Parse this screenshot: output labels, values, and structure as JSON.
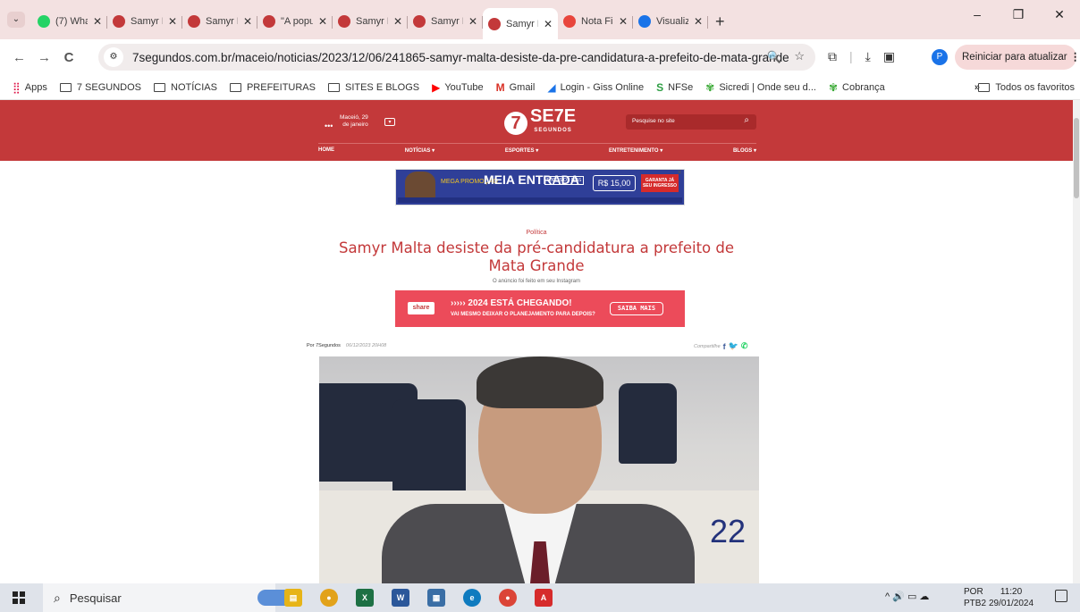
{
  "tabs": [
    {
      "label": "(7) Whats",
      "color": "#25D366",
      "active": false
    },
    {
      "label": "Samyr Ma",
      "color": "#c3393a",
      "active": false
    },
    {
      "label": "Samyr Ma",
      "color": "#c3393a",
      "active": false
    },
    {
      "label": "\"A popula",
      "color": "#c3393a",
      "active": false
    },
    {
      "label": "Samyr Ma",
      "color": "#c3393a",
      "active": false
    },
    {
      "label": "Samyr Ma",
      "color": "#c3393a",
      "active": false
    },
    {
      "label": "Samyr Ma",
      "color": "#c3393a",
      "active": true
    },
    {
      "label": "Nota Fisc",
      "color": "#e8453c",
      "active": false
    },
    {
      "label": "Visualizaç",
      "color": "#1a73e8",
      "active": false
    }
  ],
  "toolbar": {
    "url": "7segundos.com.br/maceio/noticias/2023/12/06/241865-samyr-malta-desiste-da-pre-candidatura-a-prefeito-de-mata-grande",
    "reload_label": "Reiniciar para atualizar",
    "profile_letter": "P"
  },
  "bookmarks": {
    "apps": "Apps",
    "items": [
      "7 SEGUNDOS",
      "NOTÍCIAS",
      "PREFEITURAS",
      "SITES E BLOGS",
      "YouTube",
      "Gmail",
      "Login - Giss Online",
      "NFSe",
      "Sicredi | Onde seu d...",
      "Cobrança"
    ],
    "more": "»",
    "all": "Todos os favoritos"
  },
  "site": {
    "date_line1": "Maceió, 29",
    "date_line2": "de janeiro",
    "logo_text": "SE7E",
    "logo_sub": "SEGUNDOS",
    "search_placeholder": "Pesquise no site",
    "menu": [
      "HOME",
      "NOTÍCIAS ▾",
      "ESPORTES ▾",
      "ENTRETENIMENTO ▾",
      "BLOGS ▾"
    ]
  },
  "ad1": {
    "promo": "MEGA PROMOÇÃO",
    "title": "MEIA ENTRADA",
    "note": "TODOS OS DIAS",
    "price": "R$ 15,00",
    "cta": "GARANTA JÁ SEU INGRESSO"
  },
  "article": {
    "category": "Política",
    "title": "Samyr Malta desiste da pré-candidatura a prefeito de Mata Grande",
    "subtitle": "O anúncio foi feito em seu Instagram",
    "author": "Por 7Segundos",
    "date": "06/12/2023 20H08",
    "share_label": "Compartilhe",
    "photo_number": "22"
  },
  "ad2": {
    "brand": "share",
    "line1": "›››››  2024 ESTÁ CHEGANDO!",
    "line2": "VAI MESMO DEIXAR O PLANEJAMENTO PARA DEPOIS?",
    "cta": "SAIBA MAIS"
  },
  "taskbar": {
    "search_placeholder": "Pesquisar",
    "lang1": "POR",
    "lang2": "PTB2",
    "time": "11:20",
    "date": "29/01/2024"
  }
}
